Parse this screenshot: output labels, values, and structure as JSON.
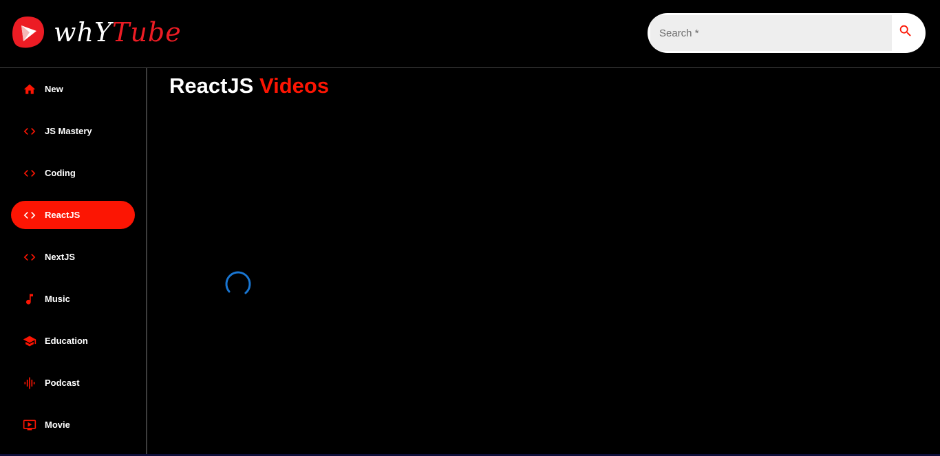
{
  "header": {
    "brand": {
      "prefix": "whY",
      "suffix": "Tube"
    },
    "search": {
      "placeholder": "Search *",
      "value": ""
    }
  },
  "sidebar": {
    "selected": "ReactJS",
    "items": [
      {
        "label": "New",
        "icon": "home-icon"
      },
      {
        "label": "JS Mastery",
        "icon": "code-icon"
      },
      {
        "label": "Coding",
        "icon": "code-icon"
      },
      {
        "label": "ReactJS",
        "icon": "code-icon"
      },
      {
        "label": "NextJS",
        "icon": "code-icon"
      },
      {
        "label": "Music",
        "icon": "music-note-icon"
      },
      {
        "label": "Education",
        "icon": "school-icon"
      },
      {
        "label": "Podcast",
        "icon": "graphic-eq-icon"
      },
      {
        "label": "Movie",
        "icon": "tv-icon"
      }
    ]
  },
  "main": {
    "title": {
      "category": "ReactJS",
      "suffix": "Videos"
    },
    "loading": true
  },
  "colors": {
    "accent": "#fc1503",
    "brand_red": "#ec1c24",
    "background": "#000000",
    "divider": "#3d3d3d",
    "spinner": "#1976d2"
  }
}
